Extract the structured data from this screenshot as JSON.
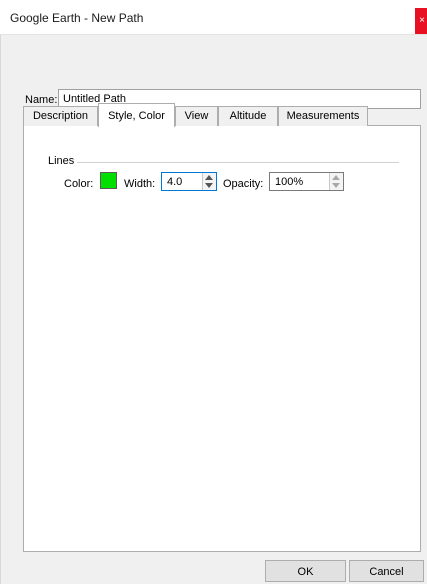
{
  "window": {
    "title": "Google Earth - New Path",
    "close_glyph": "×"
  },
  "name_field": {
    "label": "Name:",
    "value": "Untitled Path"
  },
  "tabs": [
    {
      "label": "Description",
      "active": false
    },
    {
      "label": "Style, Color",
      "active": true
    },
    {
      "label": "View",
      "active": false
    },
    {
      "label": "Altitude",
      "active": false
    },
    {
      "label": "Measurements",
      "active": false
    }
  ],
  "lines": {
    "group_label": "Lines",
    "color_label": "Color:",
    "color": "#00e000",
    "width_label": "Width:",
    "width_value": "4.0",
    "opacity_label": "Opacity:",
    "opacity_value": "100%"
  },
  "buttons": {
    "ok": "OK",
    "cancel": "Cancel"
  },
  "colors": {
    "accent": "#0078d7",
    "close": "#e81123"
  }
}
